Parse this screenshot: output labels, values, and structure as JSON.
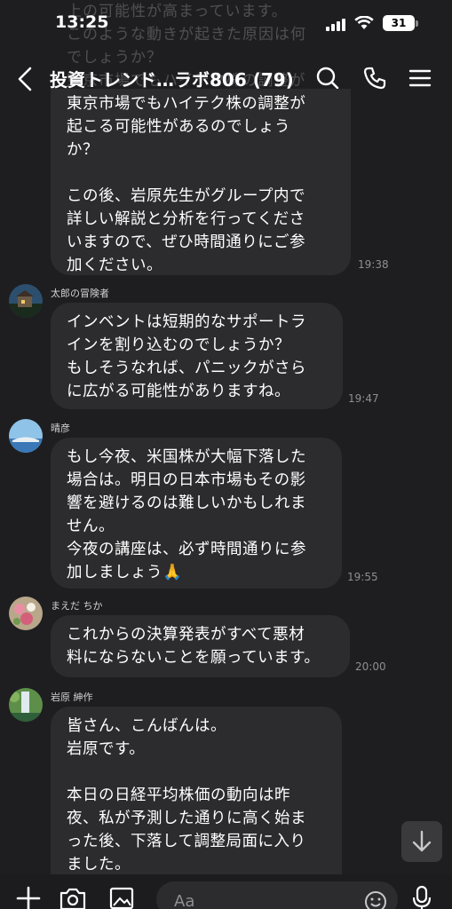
{
  "status_bar": {
    "time": "13:25",
    "battery": "31"
  },
  "header": {
    "title": "投資トレンド…ラボ806 (79)"
  },
  "ghost_lines": [
    "上の可能性が高まっています。",
    "このような動きが起きた原因は何",
    "でしょうか？",
    "東京市場でもハイテク株の調整が"
  ],
  "messages": [
    {
      "lines": [
        "東京市場でもハイテク株の調整が",
        "起こる可能性があるのでしょう",
        "か？",
        "",
        "この後、岩原先生がグループ内で",
        "詳しい解説と分析を行ってくださ",
        "いますので、ぜひ時間通りにご参",
        "加ください。"
      ],
      "time": "19:38"
    },
    {
      "sender": "太郎の冒険者",
      "lines": [
        "インベントは短期的なサポートラ",
        "インを割り込むのでしょうか？",
        "もしそうなれば、パニックがさら",
        "に広がる可能性がありますね。"
      ],
      "time": "19:47"
    },
    {
      "sender": "晴彦",
      "lines": [
        "もし今夜、米国株が大幅下落した",
        "場合は。明日の日本市場もその影",
        "響を避けるのは難しいかもしれま",
        "せん。",
        "今夜の講座は、必ず時間通りに参",
        "加しましょう🙏"
      ],
      "time": "19:55"
    },
    {
      "sender": "まえだ ちか",
      "lines": [
        "これからの決算発表がすべて悪材",
        "料にならないことを願っています。"
      ],
      "time": "20:00"
    },
    {
      "sender": "岩原 紳作",
      "lines": [
        "皆さん、こんばんは。",
        "岩原です。",
        "",
        "本日の日経平均株価の動向は昨",
        "夜、私が予測した通りに高く始ま",
        "った後、下落して調整局面に入り",
        "ました。"
      ]
    }
  ],
  "input": {
    "placeholder": "Aa"
  }
}
